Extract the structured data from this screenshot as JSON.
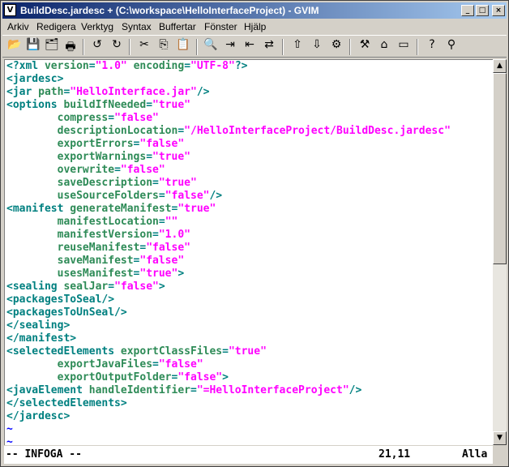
{
  "window": {
    "title": "BuildDesc.jardesc + (C:\\workspace\\HelloInterfaceProject) - GVIM"
  },
  "titlebar_buttons": {
    "minimize": "_",
    "maximize": "□",
    "close": "×"
  },
  "menu": [
    "Arkiv",
    "Redigera",
    "Verktyg",
    "Syntax",
    "Buffertar",
    "Fönster",
    "Hjälp"
  ],
  "toolbar": {
    "icons": [
      "open-icon",
      "save-icon",
      "save-all-icon",
      "print-icon",
      "undo-icon",
      "redo-icon",
      "cut-icon",
      "copy-icon",
      "paste-icon",
      "find-icon",
      "find-next-icon",
      "find-prev-icon",
      "replace-icon",
      "load-session-icon",
      "save-session-icon",
      "run-script-icon",
      "make-icon",
      "shell-icon",
      "tag-jump-icon",
      "help-icon",
      "find-help-icon"
    ]
  },
  "editor": {
    "lines": [
      [
        [
          "tag",
          "<?xml "
        ],
        [
          "attr",
          "version"
        ],
        [
          "tag",
          "="
        ],
        [
          "val",
          "\"1.0\""
        ],
        [
          "tag",
          " "
        ],
        [
          "attr",
          "encoding"
        ],
        [
          "tag",
          "="
        ],
        [
          "val",
          "\"UTF-8\""
        ],
        [
          "tag",
          "?>"
        ]
      ],
      [
        [
          "tag",
          "<jardesc>"
        ]
      ],
      [
        [
          "tag",
          "<jar "
        ],
        [
          "attr",
          "path"
        ],
        [
          "tag",
          "="
        ],
        [
          "val",
          "\"HelloInterface.jar\""
        ],
        [
          "tag",
          "/>"
        ]
      ],
      [
        [
          "tag",
          "<options "
        ],
        [
          "attr",
          "buildIfNeeded"
        ],
        [
          "tag",
          "="
        ],
        [
          "val",
          "\"true\""
        ]
      ],
      [
        [
          "tag",
          "        "
        ],
        [
          "attr",
          "compress"
        ],
        [
          "tag",
          "="
        ],
        [
          "val",
          "\"false\""
        ]
      ],
      [
        [
          "tag",
          "        "
        ],
        [
          "attr",
          "descriptionLocation"
        ],
        [
          "tag",
          "="
        ],
        [
          "val",
          "\"/HelloInterfaceProject/BuildDesc.jardesc\""
        ]
      ],
      [
        [
          "tag",
          "        "
        ],
        [
          "attr",
          "exportErrors"
        ],
        [
          "tag",
          "="
        ],
        [
          "val",
          "\"false\""
        ]
      ],
      [
        [
          "tag",
          "        "
        ],
        [
          "attr",
          "exportWarnings"
        ],
        [
          "tag",
          "="
        ],
        [
          "val",
          "\"true\""
        ]
      ],
      [
        [
          "tag",
          "        "
        ],
        [
          "attr",
          "overwrite"
        ],
        [
          "tag",
          "="
        ],
        [
          "val",
          "\"false\""
        ]
      ],
      [
        [
          "tag",
          "        "
        ],
        [
          "attr",
          "saveDescription"
        ],
        [
          "tag",
          "="
        ],
        [
          "val",
          "\"true\""
        ]
      ],
      [
        [
          "tag",
          "        "
        ],
        [
          "attr",
          "useSourceFolders"
        ],
        [
          "tag",
          "="
        ],
        [
          "val",
          "\"false\""
        ],
        [
          "tag",
          "/>"
        ]
      ],
      [
        [
          "tag",
          "<manifest "
        ],
        [
          "attr",
          "generateManifest"
        ],
        [
          "tag",
          "="
        ],
        [
          "val",
          "\"true\""
        ]
      ],
      [
        [
          "tag",
          "        "
        ],
        [
          "attr",
          "manifestLocation"
        ],
        [
          "tag",
          "="
        ],
        [
          "val",
          "\"\""
        ]
      ],
      [
        [
          "tag",
          "        "
        ],
        [
          "attr",
          "manifestVersion"
        ],
        [
          "tag",
          "="
        ],
        [
          "val",
          "\"1.0\""
        ]
      ],
      [
        [
          "tag",
          "        "
        ],
        [
          "attr",
          "reuseManifest"
        ],
        [
          "tag",
          "="
        ],
        [
          "val",
          "\"false\""
        ]
      ],
      [
        [
          "tag",
          "        "
        ],
        [
          "attr",
          "saveManifest"
        ],
        [
          "tag",
          "="
        ],
        [
          "val",
          "\"false\""
        ]
      ],
      [
        [
          "tag",
          "        "
        ],
        [
          "attr",
          "usesManifest"
        ],
        [
          "tag",
          "="
        ],
        [
          "val",
          "\"true\""
        ],
        [
          "tag",
          ">"
        ]
      ],
      [
        [
          "tag",
          "<sealing "
        ],
        [
          "attr",
          "sealJar"
        ],
        [
          "tag",
          "="
        ],
        [
          "val",
          "\"false\""
        ],
        [
          "tag",
          ">"
        ]
      ],
      [
        [
          "tag",
          "<packagesToSeal/>"
        ]
      ],
      [
        [
          "tag",
          "<packagesToUnSeal/>"
        ]
      ],
      [
        [
          "tag",
          "</sealing>"
        ]
      ],
      [
        [
          "tag",
          "</manifest>"
        ]
      ],
      [
        [
          "tag",
          "<selectedElements "
        ],
        [
          "attr",
          "exportClassFiles"
        ],
        [
          "tag",
          "="
        ],
        [
          "val",
          "\"true\""
        ]
      ],
      [
        [
          "tag",
          "        "
        ],
        [
          "attr",
          "exportJavaFiles"
        ],
        [
          "tag",
          "="
        ],
        [
          "val",
          "\"false\""
        ]
      ],
      [
        [
          "tag",
          "        "
        ],
        [
          "attr",
          "exportOutputFolder"
        ],
        [
          "tag",
          "="
        ],
        [
          "val",
          "\"false\""
        ],
        [
          "tag",
          ">"
        ]
      ],
      [
        [
          "tag",
          "<javaElement "
        ],
        [
          "attr",
          "handleIdentifier"
        ],
        [
          "tag",
          "="
        ],
        [
          "val",
          "\"=HelloInterfaceProject\""
        ],
        [
          "tag",
          "/>"
        ]
      ],
      [
        [
          "tag",
          "</selectedElements>"
        ]
      ],
      [
        [
          "tag",
          "</jardesc>"
        ]
      ],
      [
        [
          "tilde",
          "~"
        ]
      ],
      [
        [
          "tilde",
          "~"
        ]
      ]
    ],
    "colors": {
      "tag": "#008080",
      "attr": "#2e8b57",
      "val": "#ff00ff",
      "tilde": "#0000ff"
    }
  },
  "status": {
    "mode": "-- INFOGA --",
    "position": "21,11",
    "scroll": "Alla"
  }
}
